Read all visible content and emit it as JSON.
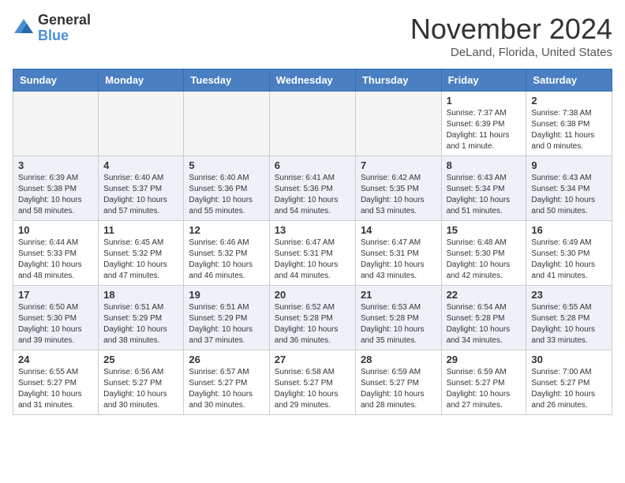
{
  "header": {
    "logo_general": "General",
    "logo_blue": "Blue",
    "month": "November 2024",
    "location": "DeLand, Florida, United States"
  },
  "weekdays": [
    "Sunday",
    "Monday",
    "Tuesday",
    "Wednesday",
    "Thursday",
    "Friday",
    "Saturday"
  ],
  "weeks": [
    {
      "alt": false,
      "days": [
        {
          "num": "",
          "empty": true
        },
        {
          "num": "",
          "empty": true
        },
        {
          "num": "",
          "empty": true
        },
        {
          "num": "",
          "empty": true
        },
        {
          "num": "",
          "empty": true
        },
        {
          "num": "1",
          "sunrise": "Sunrise: 7:37 AM",
          "sunset": "Sunset: 6:39 PM",
          "daylight": "Daylight: 11 hours and 1 minute."
        },
        {
          "num": "2",
          "sunrise": "Sunrise: 7:38 AM",
          "sunset": "Sunset: 6:38 PM",
          "daylight": "Daylight: 11 hours and 0 minutes."
        }
      ]
    },
    {
      "alt": true,
      "days": [
        {
          "num": "3",
          "sunrise": "Sunrise: 6:39 AM",
          "sunset": "Sunset: 5:38 PM",
          "daylight": "Daylight: 10 hours and 58 minutes."
        },
        {
          "num": "4",
          "sunrise": "Sunrise: 6:40 AM",
          "sunset": "Sunset: 5:37 PM",
          "daylight": "Daylight: 10 hours and 57 minutes."
        },
        {
          "num": "5",
          "sunrise": "Sunrise: 6:40 AM",
          "sunset": "Sunset: 5:36 PM",
          "daylight": "Daylight: 10 hours and 55 minutes."
        },
        {
          "num": "6",
          "sunrise": "Sunrise: 6:41 AM",
          "sunset": "Sunset: 5:36 PM",
          "daylight": "Daylight: 10 hours and 54 minutes."
        },
        {
          "num": "7",
          "sunrise": "Sunrise: 6:42 AM",
          "sunset": "Sunset: 5:35 PM",
          "daylight": "Daylight: 10 hours and 53 minutes."
        },
        {
          "num": "8",
          "sunrise": "Sunrise: 6:43 AM",
          "sunset": "Sunset: 5:34 PM",
          "daylight": "Daylight: 10 hours and 51 minutes."
        },
        {
          "num": "9",
          "sunrise": "Sunrise: 6:43 AM",
          "sunset": "Sunset: 5:34 PM",
          "daylight": "Daylight: 10 hours and 50 minutes."
        }
      ]
    },
    {
      "alt": false,
      "days": [
        {
          "num": "10",
          "sunrise": "Sunrise: 6:44 AM",
          "sunset": "Sunset: 5:33 PM",
          "daylight": "Daylight: 10 hours and 48 minutes."
        },
        {
          "num": "11",
          "sunrise": "Sunrise: 6:45 AM",
          "sunset": "Sunset: 5:32 PM",
          "daylight": "Daylight: 10 hours and 47 minutes."
        },
        {
          "num": "12",
          "sunrise": "Sunrise: 6:46 AM",
          "sunset": "Sunset: 5:32 PM",
          "daylight": "Daylight: 10 hours and 46 minutes."
        },
        {
          "num": "13",
          "sunrise": "Sunrise: 6:47 AM",
          "sunset": "Sunset: 5:31 PM",
          "daylight": "Daylight: 10 hours and 44 minutes."
        },
        {
          "num": "14",
          "sunrise": "Sunrise: 6:47 AM",
          "sunset": "Sunset: 5:31 PM",
          "daylight": "Daylight: 10 hours and 43 minutes."
        },
        {
          "num": "15",
          "sunrise": "Sunrise: 6:48 AM",
          "sunset": "Sunset: 5:30 PM",
          "daylight": "Daylight: 10 hours and 42 minutes."
        },
        {
          "num": "16",
          "sunrise": "Sunrise: 6:49 AM",
          "sunset": "Sunset: 5:30 PM",
          "daylight": "Daylight: 10 hours and 41 minutes."
        }
      ]
    },
    {
      "alt": true,
      "days": [
        {
          "num": "17",
          "sunrise": "Sunrise: 6:50 AM",
          "sunset": "Sunset: 5:30 PM",
          "daylight": "Daylight: 10 hours and 39 minutes."
        },
        {
          "num": "18",
          "sunrise": "Sunrise: 6:51 AM",
          "sunset": "Sunset: 5:29 PM",
          "daylight": "Daylight: 10 hours and 38 minutes."
        },
        {
          "num": "19",
          "sunrise": "Sunrise: 6:51 AM",
          "sunset": "Sunset: 5:29 PM",
          "daylight": "Daylight: 10 hours and 37 minutes."
        },
        {
          "num": "20",
          "sunrise": "Sunrise: 6:52 AM",
          "sunset": "Sunset: 5:28 PM",
          "daylight": "Daylight: 10 hours and 36 minutes."
        },
        {
          "num": "21",
          "sunrise": "Sunrise: 6:53 AM",
          "sunset": "Sunset: 5:28 PM",
          "daylight": "Daylight: 10 hours and 35 minutes."
        },
        {
          "num": "22",
          "sunrise": "Sunrise: 6:54 AM",
          "sunset": "Sunset: 5:28 PM",
          "daylight": "Daylight: 10 hours and 34 minutes."
        },
        {
          "num": "23",
          "sunrise": "Sunrise: 6:55 AM",
          "sunset": "Sunset: 5:28 PM",
          "daylight": "Daylight: 10 hours and 33 minutes."
        }
      ]
    },
    {
      "alt": false,
      "days": [
        {
          "num": "24",
          "sunrise": "Sunrise: 6:55 AM",
          "sunset": "Sunset: 5:27 PM",
          "daylight": "Daylight: 10 hours and 31 minutes."
        },
        {
          "num": "25",
          "sunrise": "Sunrise: 6:56 AM",
          "sunset": "Sunset: 5:27 PM",
          "daylight": "Daylight: 10 hours and 30 minutes."
        },
        {
          "num": "26",
          "sunrise": "Sunrise: 6:57 AM",
          "sunset": "Sunset: 5:27 PM",
          "daylight": "Daylight: 10 hours and 30 minutes."
        },
        {
          "num": "27",
          "sunrise": "Sunrise: 6:58 AM",
          "sunset": "Sunset: 5:27 PM",
          "daylight": "Daylight: 10 hours and 29 minutes."
        },
        {
          "num": "28",
          "sunrise": "Sunrise: 6:59 AM",
          "sunset": "Sunset: 5:27 PM",
          "daylight": "Daylight: 10 hours and 28 minutes."
        },
        {
          "num": "29",
          "sunrise": "Sunrise: 6:59 AM",
          "sunset": "Sunset: 5:27 PM",
          "daylight": "Daylight: 10 hours and 27 minutes."
        },
        {
          "num": "30",
          "sunrise": "Sunrise: 7:00 AM",
          "sunset": "Sunset: 5:27 PM",
          "daylight": "Daylight: 10 hours and 26 minutes."
        }
      ]
    }
  ]
}
